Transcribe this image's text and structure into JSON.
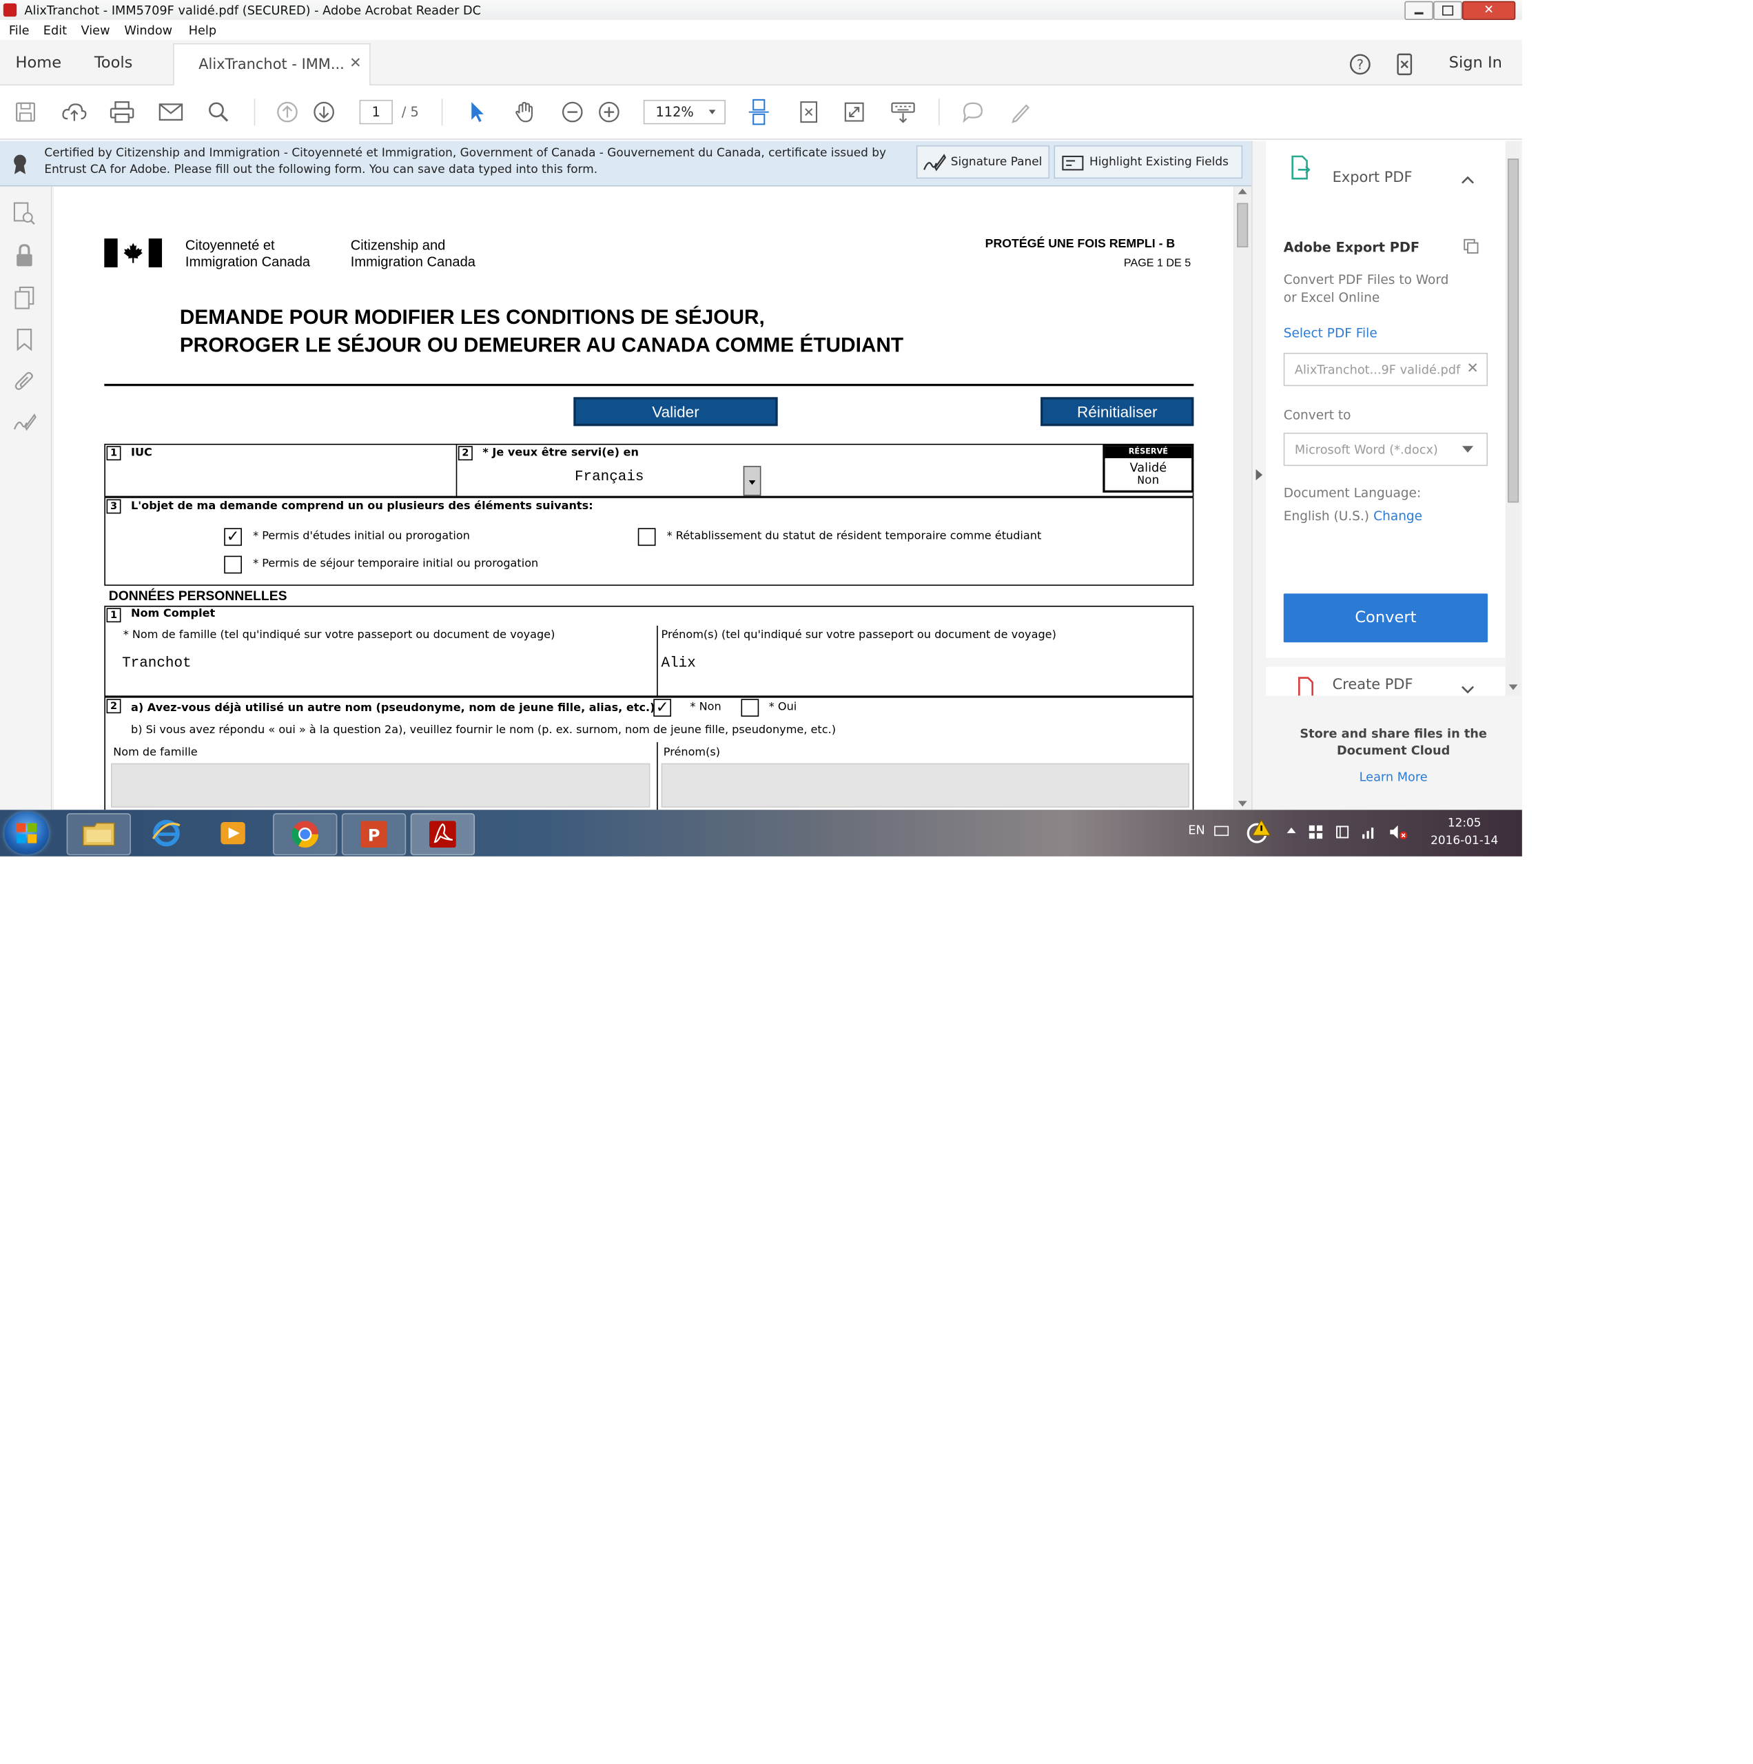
{
  "window": {
    "title": "AlixTranchot - IMM5709F validé.pdf (SECURED) - Adobe Acrobat Reader DC"
  },
  "menu": {
    "items": [
      "File",
      "Edit",
      "View",
      "Window",
      "Help"
    ]
  },
  "tabs": {
    "home": "Home",
    "tools": "Tools",
    "document": "AlixTranchot - IMM...",
    "sign_in": "Sign In"
  },
  "toolbar": {
    "page_current": "1",
    "page_total": "/ 5",
    "zoom": "112%"
  },
  "cert_bar": {
    "line1": "Certified by Citizenship and Immigration - Citoyenneté et Immigration, Government of Canada - Gouvernement du Canada, certificate issued by",
    "line2": "Entrust CA for Adobe.  Please fill out the following form. You can save data typed into this form.",
    "signature_panel": "Signature Panel",
    "highlight_fields": "Highlight Existing Fields"
  },
  "form": {
    "agency_fr_1": "Citoyenneté et",
    "agency_fr_2": "Immigration Canada",
    "agency_en_1": "Citizenship and",
    "agency_en_2": "Immigration Canada",
    "protected": "PROTÉGÉ UNE FOIS REMPLI - B",
    "page_of": "PAGE 1 DE 5",
    "title_1": "DEMANDE POUR MODIFIER LES CONDITIONS DE SÉJOUR,",
    "title_2": "PROROGER LE SÉJOUR OU DEMEURER AU CANADA COMME ÉTUDIANT",
    "validate_btn": "Valider",
    "reset_btn": "Réinitialiser",
    "q1_num": "1",
    "q1_label": "IUC",
    "q2_num": "2",
    "q2_label": "* Je veux être servi(e) en",
    "q2_value": "Français",
    "reserved_title": "RÉSERVÉ",
    "reserved_l1": "Validé",
    "reserved_l2": "Non",
    "q3_num": "3",
    "q3_label": "L'objet de ma demande comprend un ou plusieurs des éléments suivants:",
    "opt_study": "* Permis d'études initial ou prorogation",
    "opt_restore": "* Rétablissement du statut de résident temporaire comme étudiant",
    "opt_visitor": "* Permis de séjour temporaire initial ou prorogation",
    "opt_study_checked": "✓",
    "section_personal": "DONNÉES PERSONNELLES",
    "p1_num": "1",
    "p1_label": "Nom Complet",
    "surname_label": "* Nom de famille (tel qu'indiqué sur votre passeport ou document de voyage)",
    "surname_value": "Tranchot",
    "given_label": "Prénom(s) (tel qu'indiqué sur votre passeport ou document de voyage)",
    "given_value": "Alix",
    "p2_num": "2",
    "p2a_label": "a) Avez-vous déjà utilisé un autre nom (pseudonyme, nom de jeune fille, alias, etc.)?",
    "p2a_non": "* Non",
    "p2a_oui": "* Oui",
    "p2a_non_checked": "✓",
    "p2b_label": "b) Si vous avez répondu « oui » à la question 2a), veuillez fournir le nom (p. ex. surnom, nom de jeune fille, pseudonyme, etc.)",
    "other_surname_label": "Nom de famille",
    "other_given_label": "Prénom(s)"
  },
  "right_pane": {
    "export_header": "Export PDF",
    "adobe_export": "Adobe Export PDF",
    "desc_1": "Convert PDF Files to Word",
    "desc_2": "or Excel Online",
    "select_file": "Select PDF File",
    "file_name": "AlixTranchot...9F validé.pdf",
    "convert_to": "Convert to",
    "format": "Microsoft Word (*.docx)",
    "doc_language": "Document Language:",
    "language": "English (U.S.)",
    "change": "Change",
    "convert_btn": "Convert",
    "create_pdf": "Create PDF",
    "store_1": "Store and share files in the",
    "store_2": "Document Cloud",
    "learn_more": "Learn More"
  },
  "taskbar": {
    "lang": "EN",
    "time": "12:05",
    "date": "2016-01-14"
  },
  "colors": {
    "accent_blue": "#2b7bd6",
    "form_button": "#0f4f8c",
    "cert_bar": "#dce8f3"
  }
}
